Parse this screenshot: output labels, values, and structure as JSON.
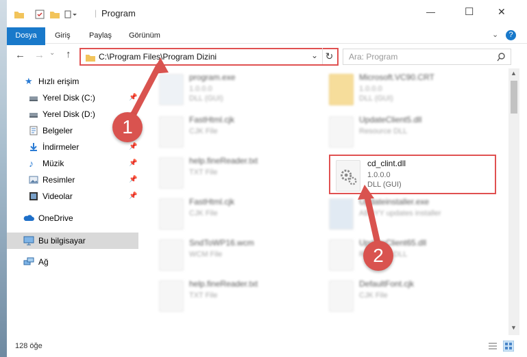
{
  "window": {
    "title": "Program"
  },
  "controls": {
    "minimize": "—",
    "maximize": "☐",
    "close": "✕"
  },
  "ribbon": {
    "tabs": [
      "Dosya",
      "Giriş",
      "Paylaş",
      "Görünüm"
    ],
    "help": "?"
  },
  "nav": {
    "path": "C:\\Program Files\\Program Dizini",
    "search_placeholder": "Ara: Program"
  },
  "sidebar": {
    "quick_access": "Hızlı erişim",
    "items": [
      "Yerel Disk (C:)",
      "Yerel Disk (D:)",
      "Belgeler",
      "İndirmeler",
      "Müzik",
      "Resimler",
      "Videolar"
    ],
    "onedrive": "OneDrive",
    "this_pc": "Bu bilgisayar",
    "network": "Ağ"
  },
  "files": [
    {
      "name": "program.exe",
      "line1": "1.0.0.0",
      "line2": "DLL (GUI)"
    },
    {
      "name": "Microsoft.VC90.CRT",
      "line1": "1.0.0.0",
      "line2": "DLL (GUI)"
    },
    {
      "name": "FastHtml.cjk",
      "line1": "CJK File",
      "line2": ""
    },
    {
      "name": "UpdateClient5.dll",
      "line1": "Resource DLL",
      "line2": ""
    },
    {
      "name": "help.fineReader.txt",
      "line1": "TXT File",
      "line2": ""
    },
    {
      "name": "cd_clint.dll",
      "line1": "1.0.0.0",
      "line2": "DLL (GUI)"
    },
    {
      "name": "FastHtml.cjk",
      "line1": "CJK File",
      "line2": ""
    },
    {
      "name": "Updateinstaller.exe",
      "line1": "ABBYY updates installer",
      "line2": ""
    },
    {
      "name": "SndToWP16.wcm",
      "line1": "WCM File",
      "line2": ""
    },
    {
      "name": "UpdateClient65.dll",
      "line1": "Resource DLL",
      "line2": ""
    },
    {
      "name": "help.fineReader.txt",
      "line1": "TXT File",
      "line2": ""
    },
    {
      "name": "DefaultFont.cjk",
      "line1": "CJK File",
      "line2": ""
    }
  ],
  "status": {
    "count": "128 öğe"
  },
  "callouts": [
    "1",
    "2"
  ],
  "colors": {
    "accent": "#1979ca",
    "highlight": "#e05050",
    "callout": "#d9534f"
  }
}
